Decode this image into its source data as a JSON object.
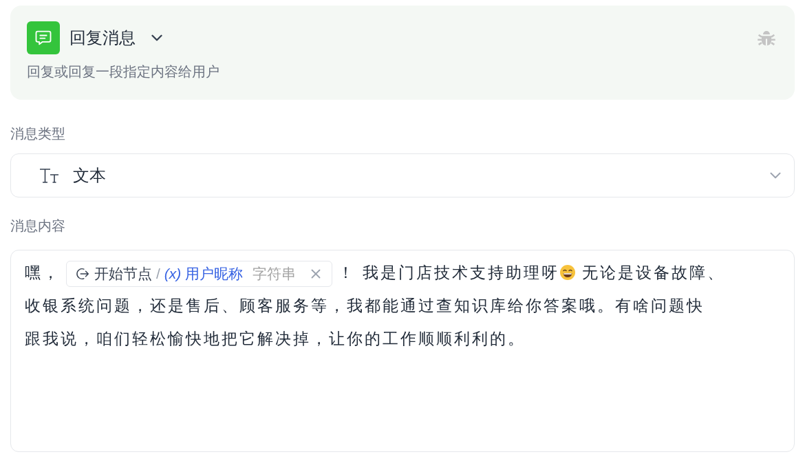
{
  "header": {
    "title": "回复消息",
    "description": "回复或回复一段指定内容给用户"
  },
  "message_type": {
    "label": "消息类型",
    "value": "文本"
  },
  "message_content": {
    "label": "消息内容",
    "segments": [
      {
        "kind": "text",
        "text": "嘿，"
      },
      {
        "kind": "variable",
        "source": "开始节点",
        "separator": "/",
        "symbol": "(x)",
        "name": "用户昵称",
        "type": "字符串"
      },
      {
        "kind": "text",
        "text": "！ 我是门店技术支持助理呀"
      },
      {
        "kind": "emoji"
      },
      {
        "kind": "text",
        "text": " 无论是设备故障、"
      },
      {
        "kind": "text",
        "text": "收银系统问题，还是售后、顾客服务等，我都能通过查知识库给你答案哦。有啥问题快"
      },
      {
        "kind": "text",
        "text": "跟我说，咱们轻松愉快地把它解决掉，让你的工作顺顺利利的。"
      }
    ]
  }
}
